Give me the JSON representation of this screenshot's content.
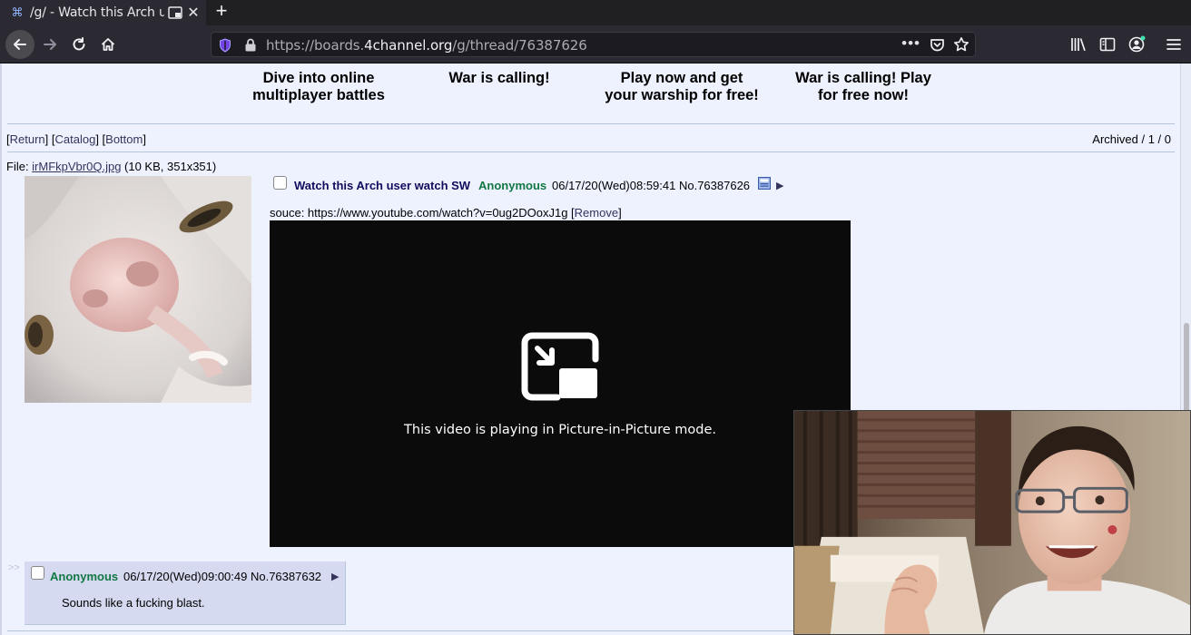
{
  "tab": {
    "title": "/g/ - Watch this Arch user watch SW",
    "close_glyph": "✕",
    "new_tab_glyph": "+",
    "favicon_glyph": "⌘"
  },
  "url": {
    "prefix": "https://boards.",
    "domain": "4channel.org",
    "path": "/g/thread/76387626"
  },
  "ads": [
    {
      "line1": "Dive into online",
      "line2": "multiplayer battles"
    },
    {
      "line1": "War is calling!",
      "line2": ""
    },
    {
      "line1": "Play now and get",
      "line2": "your warship for free!"
    },
    {
      "line1": "War is calling! Play",
      "line2": "for free now!"
    }
  ],
  "nav": {
    "open": "[",
    "return": "Return",
    "sep1": "] [",
    "catalog": "Catalog",
    "sep2": "] [",
    "bottom": "Bottom",
    "close": "]"
  },
  "archived": "Archived / 1 / 0",
  "file": {
    "prefix": "File: ",
    "name": "irMFkpVbr0Q.jpg",
    "meta": " (10 KB, 351x351)"
  },
  "op": {
    "subject": "Watch this Arch user watch SW",
    "name": "Anonymous",
    "datetime": "06/17/20(Wed)08:59:41 No.76387626",
    "body_prefix": "souce: https://www.youtube.com/watch?v=0ug2DOoxJ1g [",
    "remove": "Remove",
    "body_suffix": "]"
  },
  "video": {
    "message": "This video is playing in Picture-in-Picture mode."
  },
  "reply": {
    "arrows": ">>",
    "name": "Anonymous",
    "datetime": "06/17/20(Wed)09:00:49 No.76387632",
    "message": "Sounds like a fucking blast."
  },
  "colors": {
    "page_bg": "#eef2ff",
    "reply_bg": "#d6daf0",
    "name_green": "#117743",
    "subject_blue": "#0f0c5d",
    "link": "#34345c"
  }
}
